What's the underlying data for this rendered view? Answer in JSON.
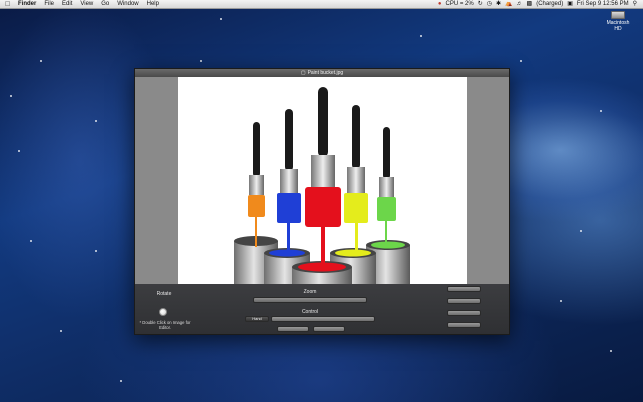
{
  "menubar": {
    "app_name": "Finder",
    "menus": [
      "File",
      "Edit",
      "View",
      "Go",
      "Window",
      "Help"
    ],
    "cpu_status": "CPU = 2%",
    "battery_status": "(Charged)",
    "clock": "Fri Sep 9 12:56 PM"
  },
  "desktop": {
    "disk_label_line1": "Macintosh",
    "disk_label_line2": "HD"
  },
  "window": {
    "title": "Paint bucket.jpg"
  },
  "panel": {
    "rotate_label": "Rotate",
    "rotate_note": "* Double Click on Image for Editor.",
    "zoom_label": "Zoom",
    "control_label": "Control",
    "hand_label": "Hand"
  },
  "colors": {
    "orange": "#f08a1c",
    "blue": "#1f3fd6",
    "red": "#e4101c",
    "yellow": "#e4ec1c",
    "green": "#6cd64a"
  }
}
